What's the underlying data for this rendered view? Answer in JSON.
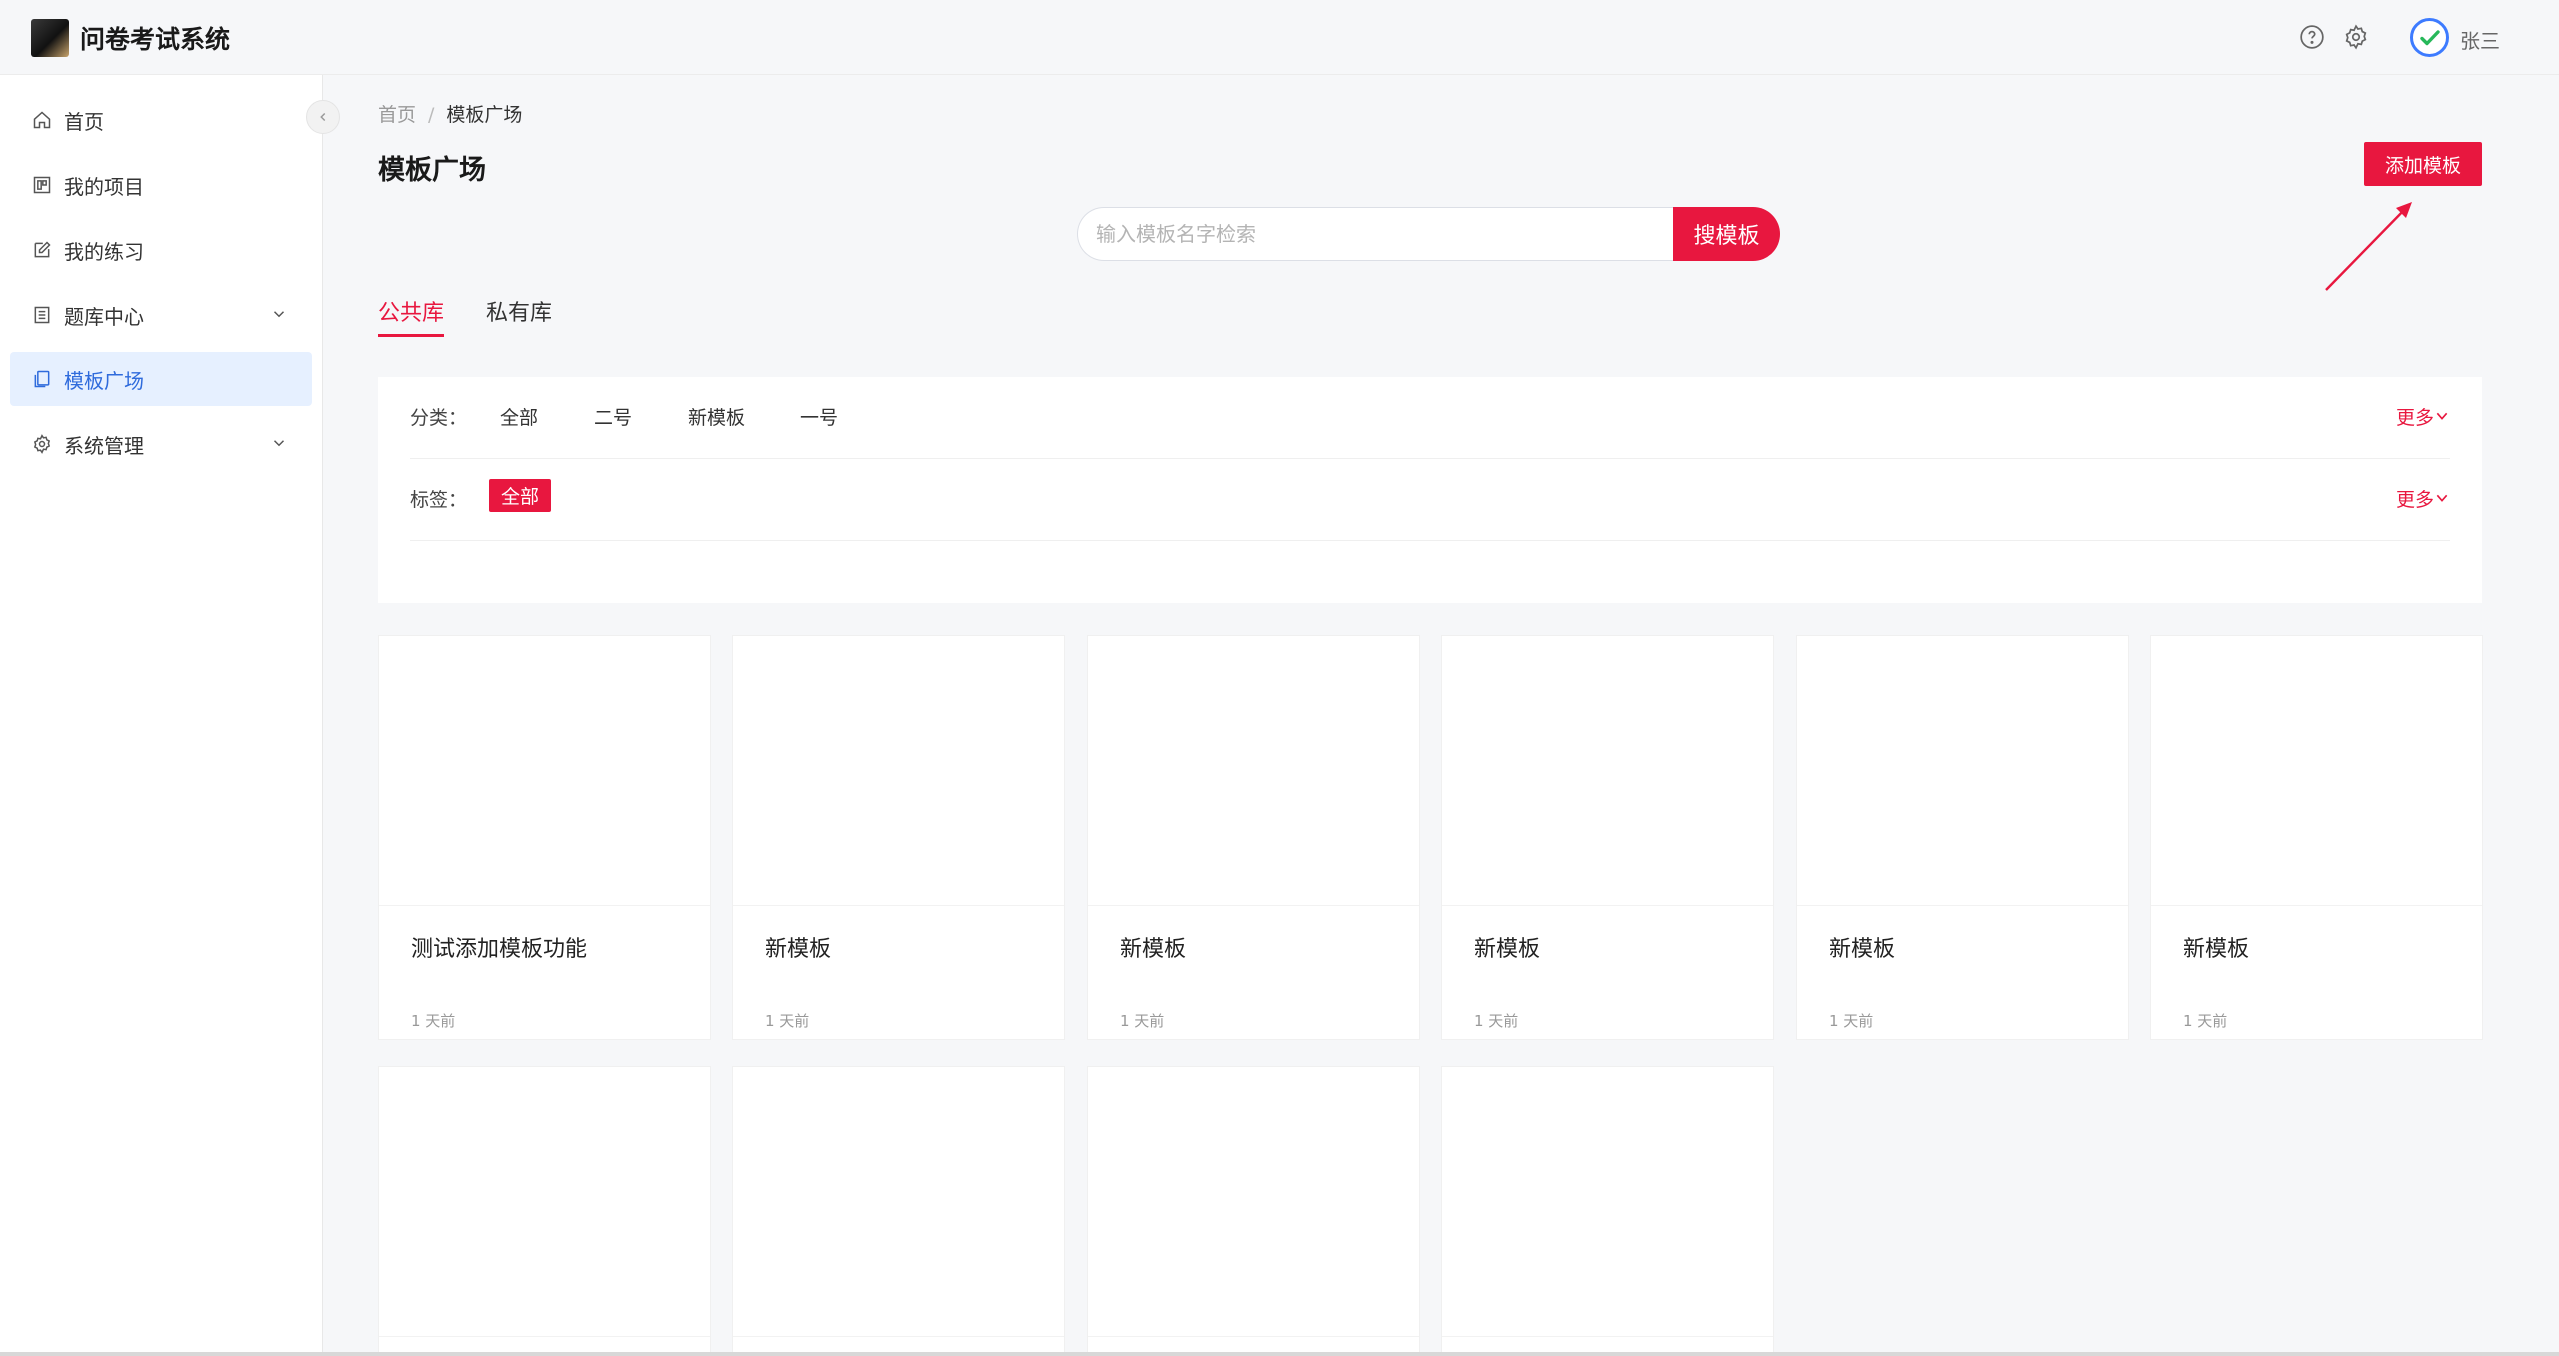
{
  "header": {
    "app_title": "问卷考试系统",
    "help_icon": "help-circle-icon",
    "settings_icon": "gear-icon",
    "user_name": "张三"
  },
  "sidebar": {
    "items": [
      {
        "label": "首页",
        "icon": "home-icon"
      },
      {
        "label": "我的项目",
        "icon": "project-icon"
      },
      {
        "label": "我的练习",
        "icon": "edit-icon"
      },
      {
        "label": "题库中心",
        "icon": "list-icon",
        "expandable": true
      },
      {
        "label": "模板广场",
        "icon": "template-icon",
        "active": true
      },
      {
        "label": "系统管理",
        "icon": "gear-icon",
        "expandable": true
      }
    ]
  },
  "breadcrumb": {
    "home": "首页",
    "separator": "/",
    "current": "模板广场"
  },
  "page": {
    "title": "模板广场",
    "add_button": "添加模板"
  },
  "search": {
    "placeholder": "输入模板名字检索",
    "button": "搜模板"
  },
  "tabs": [
    {
      "label": "公共库",
      "active": true
    },
    {
      "label": "私有库",
      "active": false
    }
  ],
  "filters": {
    "category_label": "分类：",
    "categories": [
      "全部",
      "二号",
      "新模板",
      "一号"
    ],
    "tag_label": "标签：",
    "tag_selected": "全部",
    "more": "更多"
  },
  "templates": [
    {
      "name": "测试添加模板功能",
      "time": "1 天前"
    },
    {
      "name": "新模板",
      "time": "1 天前"
    },
    {
      "name": "新模板",
      "time": "1 天前"
    },
    {
      "name": "新模板",
      "time": "1 天前"
    },
    {
      "name": "新模板",
      "time": "1 天前"
    },
    {
      "name": "新模板",
      "time": "1 天前"
    },
    {
      "name": "",
      "time": ""
    },
    {
      "name": "",
      "time": ""
    },
    {
      "name": "",
      "time": ""
    },
    {
      "name": "",
      "time": ""
    }
  ],
  "colors": {
    "accent": "#e8173f",
    "active_nav_bg": "#e6f0ff",
    "active_nav_text": "#2f6bdc"
  }
}
